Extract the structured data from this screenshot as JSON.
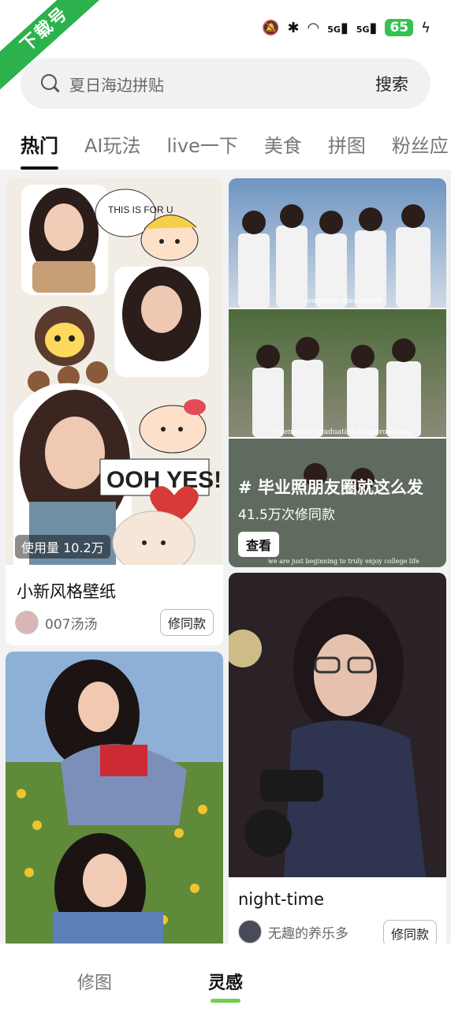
{
  "badge": "下载号",
  "status": {
    "battery": "65",
    "signal_a": "5G",
    "signal_b": "5G"
  },
  "search": {
    "placeholder": "夏日海边拼贴",
    "button": "搜索"
  },
  "tabs": [
    "热门",
    "AI玩法",
    "live一下",
    "美食",
    "拼图",
    "粉丝应"
  ],
  "cards": {
    "card1": {
      "usage": "使用量 10.2万",
      "title": "小新风格壁纸",
      "author": "007汤汤",
      "action": "修同款",
      "sticker_text": "OOH YES!",
      "note_text": "THIS IS FOR U"
    },
    "card2": {
      "title": "# 毕业照朋友圈就这么发",
      "subtitle": "41.5万次修同款",
      "action": "查看",
      "caption1": "suddenly discovered",
      "caption2": "seems like graduation is approaching",
      "caption3": "we are just beginning to truly enjoy college life"
    },
    "card3": {
      "title": "night-time",
      "author": "无趣的养乐多",
      "action": "修同款"
    }
  },
  "nav": {
    "left": "修图",
    "right": "灵感"
  },
  "colors": {
    "accent": "#6dd24f",
    "badge": "#2bb24c"
  }
}
